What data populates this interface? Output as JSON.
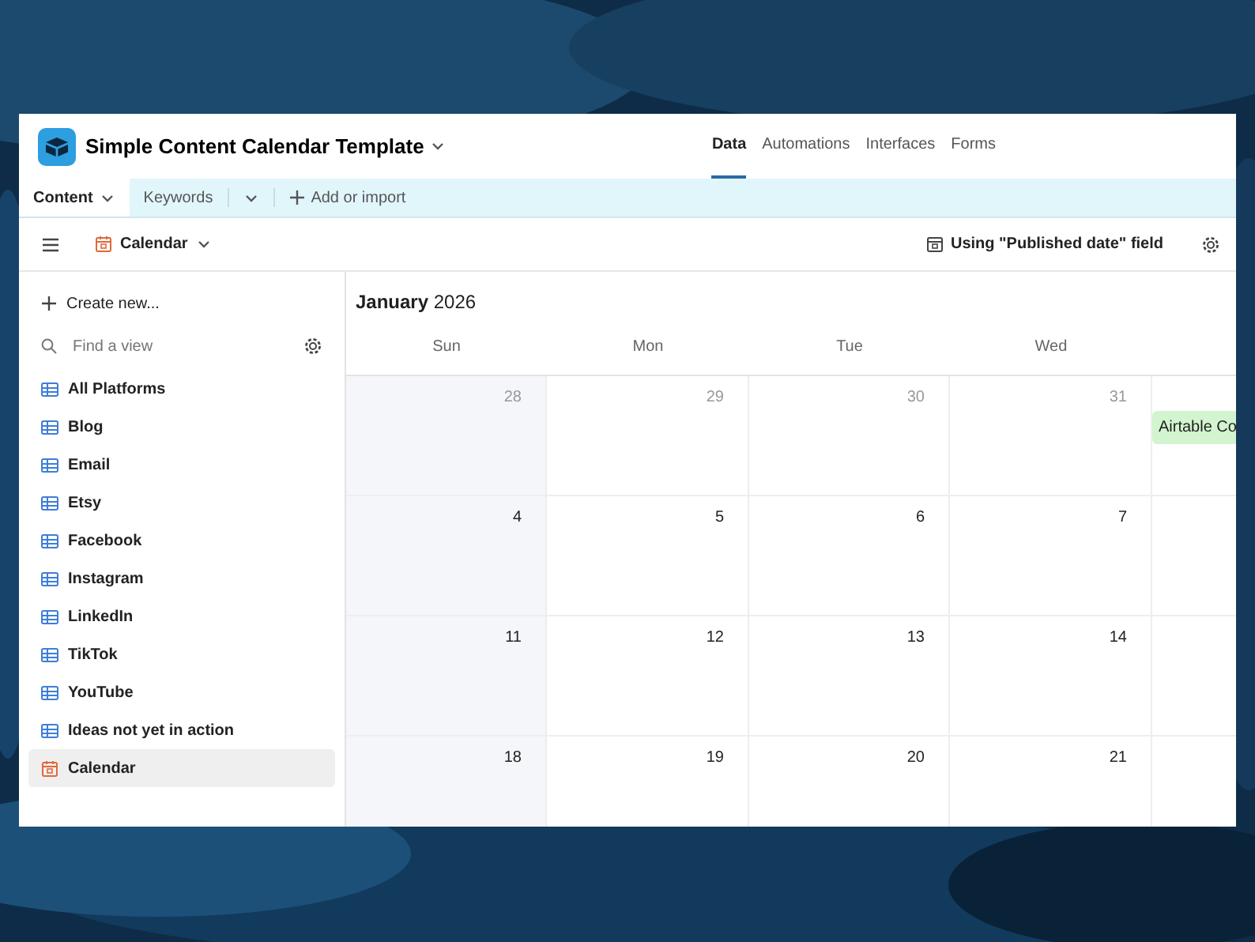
{
  "base": {
    "title": "Simple Content Calendar Template"
  },
  "top_nav": [
    {
      "label": "Data",
      "selected": true
    },
    {
      "label": "Automations",
      "selected": false
    },
    {
      "label": "Interfaces",
      "selected": false
    },
    {
      "label": "Forms",
      "selected": false
    }
  ],
  "table_tabs": [
    {
      "label": "Content",
      "selected": true
    },
    {
      "label": "Keywords",
      "selected": false
    }
  ],
  "add_table": "Add or import",
  "view_bar": {
    "view_name": "Calendar",
    "date_field": "Using \"Published date\" field"
  },
  "sidebar": {
    "create": "Create new...",
    "search_placeholder": "Find a view",
    "views": [
      {
        "label": "All Platforms",
        "kind": "grid",
        "selected": false
      },
      {
        "label": "Blog",
        "kind": "grid",
        "selected": false
      },
      {
        "label": "Email",
        "kind": "grid",
        "selected": false
      },
      {
        "label": "Etsy",
        "kind": "grid",
        "selected": false
      },
      {
        "label": "Facebook",
        "kind": "grid",
        "selected": false
      },
      {
        "label": "Instagram",
        "kind": "grid",
        "selected": false
      },
      {
        "label": "LinkedIn",
        "kind": "grid",
        "selected": false
      },
      {
        "label": "TikTok",
        "kind": "grid",
        "selected": false
      },
      {
        "label": "YouTube",
        "kind": "grid",
        "selected": false
      },
      {
        "label": "Ideas not yet in action",
        "kind": "grid",
        "selected": false
      },
      {
        "label": "Calendar",
        "kind": "calendar",
        "selected": true
      }
    ]
  },
  "calendar": {
    "month": "January",
    "year": "2026",
    "weekdays": [
      "Sun",
      "Mon",
      "Tue",
      "Wed"
    ],
    "weeks": [
      {
        "days": [
          {
            "label": "28",
            "outside": true
          },
          {
            "label": "29",
            "outside": true
          },
          {
            "label": "30",
            "outside": true
          },
          {
            "label": "31",
            "outside": true
          }
        ],
        "thu_events": [
          "Airtable Co"
        ]
      },
      {
        "days": [
          {
            "label": "4",
            "outside": false
          },
          {
            "label": "5",
            "outside": false
          },
          {
            "label": "6",
            "outside": false
          },
          {
            "label": "7",
            "outside": false
          }
        ]
      },
      {
        "days": [
          {
            "label": "11",
            "outside": false
          },
          {
            "label": "12",
            "outside": false
          },
          {
            "label": "13",
            "outside": false
          },
          {
            "label": "14",
            "outside": false
          }
        ]
      },
      {
        "days": [
          {
            "label": "18",
            "outside": false
          },
          {
            "label": "19",
            "outside": false
          },
          {
            "label": "20",
            "outside": false
          },
          {
            "label": "21",
            "outside": false
          }
        ]
      }
    ]
  }
}
